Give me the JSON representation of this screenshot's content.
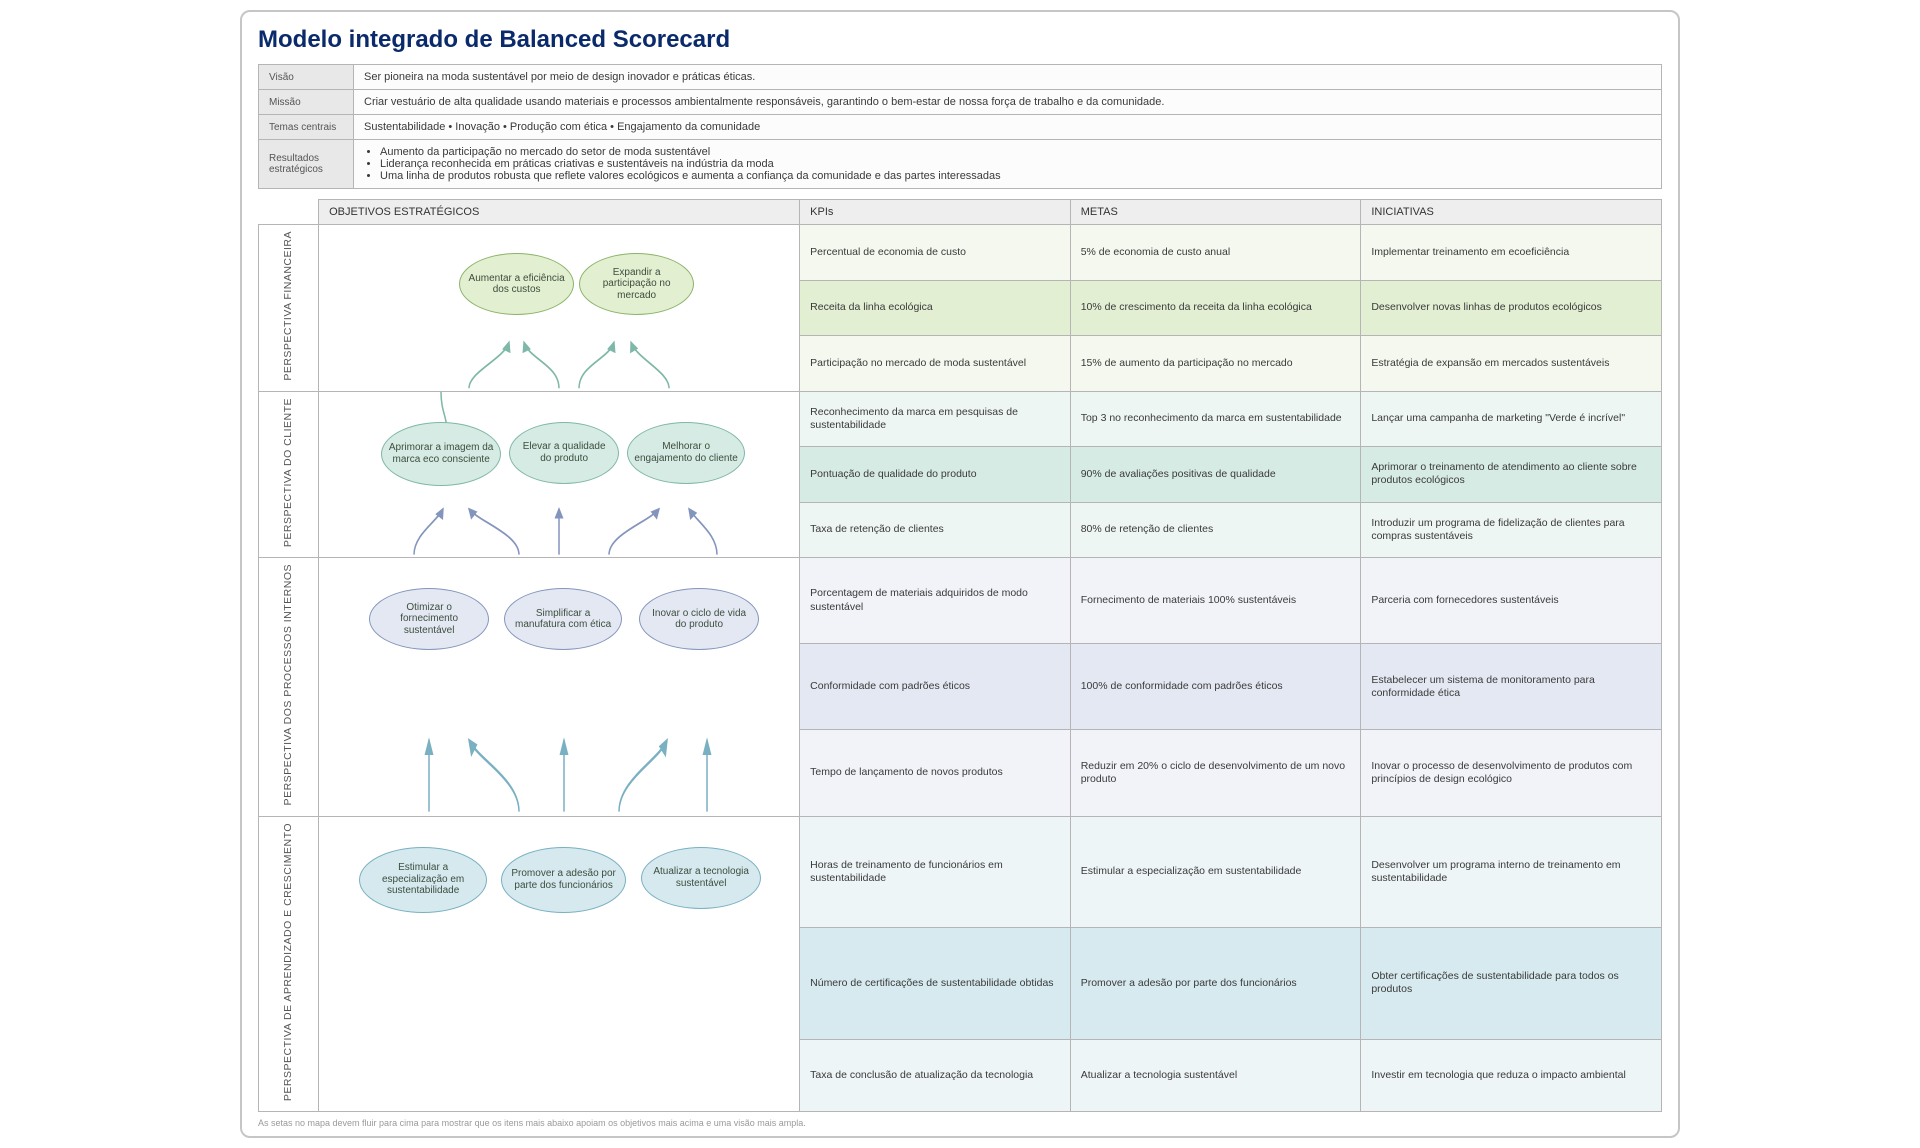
{
  "title": "Modelo integrado de Balanced Scorecard",
  "meta": {
    "visao_lbl": "Visão",
    "visao": "Ser pioneira na moda sustentável por meio de design inovador e práticas éticas.",
    "missao_lbl": "Missão",
    "missao": "Criar vestuário de alta qualidade usando materiais e processos ambientalmente responsáveis, garantindo o bem-estar de nossa força de trabalho e da comunidade.",
    "temas_lbl": "Temas centrais",
    "temas": "Sustentabilidade  •  Inovação  •  Produção com ética  •  Engajamento da comunidade",
    "resultados_lbl": "Resultados estratégicos",
    "resultados": [
      "Aumento da participação no mercado do setor de moda sustentável",
      "Liderança reconhecida em práticas criativas e sustentáveis na indústria da moda",
      "Uma linha de produtos robusta que reflete valores ecológicos e aumenta a confiança da comunidade e das partes interessadas"
    ]
  },
  "headers": {
    "obj": "OBJETIVOS ESTRATÉGICOS",
    "kpi": "KPIs",
    "meta": "METAS",
    "ini": "INICIATIVAS"
  },
  "perspectives": {
    "financeira": {
      "label": "PERSPECTIVA FINANCEIRA",
      "objectives": [
        "Aumentar a eficiência dos custos",
        "Expandir a participação no mercado"
      ],
      "rows": [
        {
          "kpi": "Percentual de economia de custo",
          "meta": "5% de economia de custo anual",
          "ini": "Implementar treinamento em ecoeficiência"
        },
        {
          "kpi": "Receita da linha ecológica",
          "meta": "10% de crescimento da receita da linha ecológica",
          "ini": "Desenvolver novas linhas de produtos ecológicos"
        },
        {
          "kpi": "Participação no mercado de moda sustentável",
          "meta": "15% de aumento da participação no mercado",
          "ini": "Estratégia de expansão em mercados sustentáveis"
        }
      ]
    },
    "cliente": {
      "label": "PERSPECTIVA DO CLIENTE",
      "objectives": [
        "Aprimorar a imagem da marca eco consciente",
        "Elevar a qualidade do produto",
        "Melhorar o engajamento do cliente"
      ],
      "rows": [
        {
          "kpi": "Reconhecimento da marca em pesquisas de sustentabilidade",
          "meta": "Top 3 no reconhecimento da marca em sustentabilidade",
          "ini": "Lançar uma campanha de marketing \"Verde é incrível\""
        },
        {
          "kpi": "Pontuação de qualidade do produto",
          "meta": "90% de avaliações positivas de qualidade",
          "ini": "Aprimorar o treinamento de atendimento ao cliente sobre produtos ecológicos"
        },
        {
          "kpi": "Taxa de retenção de clientes",
          "meta": "80% de retenção de clientes",
          "ini": "Introduzir um programa de fidelização de clientes para compras sustentáveis"
        }
      ]
    },
    "processos": {
      "label": "PERSPECTIVA DOS PROCESSOS INTERNOS",
      "objectives": [
        "Otimizar o fornecimento sustentável",
        "Simplificar a manufatura com ética",
        "Inovar o ciclo de vida do produto"
      ],
      "rows": [
        {
          "kpi": "Porcentagem de materiais adquiridos de modo sustentável",
          "meta": "Fornecimento de materiais 100% sustentáveis",
          "ini": "Parceria com fornecedores sustentáveis"
        },
        {
          "kpi": "Conformidade com padrões éticos",
          "meta": "100% de conformidade com padrões éticos",
          "ini": "Estabelecer um sistema de monitoramento para conformidade ética"
        },
        {
          "kpi": "Tempo de lançamento de novos produtos",
          "meta": "Reduzir em 20% o ciclo de desenvolvimento de um novo produto",
          "ini": "Inovar o processo de desenvolvimento de produtos com princípios de design ecológico"
        }
      ]
    },
    "aprendizado": {
      "label": "PERSPECTIVA DE APRENDIZADO E CRESCIMENTO",
      "objectives": [
        "Estimular a especialização em sustentabilidade",
        "Promover a adesão por parte dos funcionários",
        "Atualizar a tecnologia sustentável"
      ],
      "rows": [
        {
          "kpi": "Horas de treinamento de funcionários em sustentabilidade",
          "meta": "Estimular a especialização em sustentabilidade",
          "ini": "Desenvolver um programa interno de treinamento em sustentabilidade"
        },
        {
          "kpi": "Número de certificações de sustentabilidade obtidas",
          "meta": "Promover a adesão por parte dos funcionários",
          "ini": "Obter certificações de sustentabilidade para todos os produtos"
        },
        {
          "kpi": "Taxa de conclusão de atualização da tecnologia",
          "meta": "Atualizar a tecnologia sustentável",
          "ini": "Investir em tecnologia que reduza o impacto ambiental"
        }
      ]
    }
  },
  "footnote": "As setas no mapa devem fluir para cima para mostrar que os itens mais abaixo apoiam os objetivos mais acima e uma visão mais ampla.",
  "colors": {
    "fin": "#e2efd0",
    "cli": "#d6ebe4",
    "pro": "#e3e8f3",
    "lea": "#d5e9ef"
  }
}
